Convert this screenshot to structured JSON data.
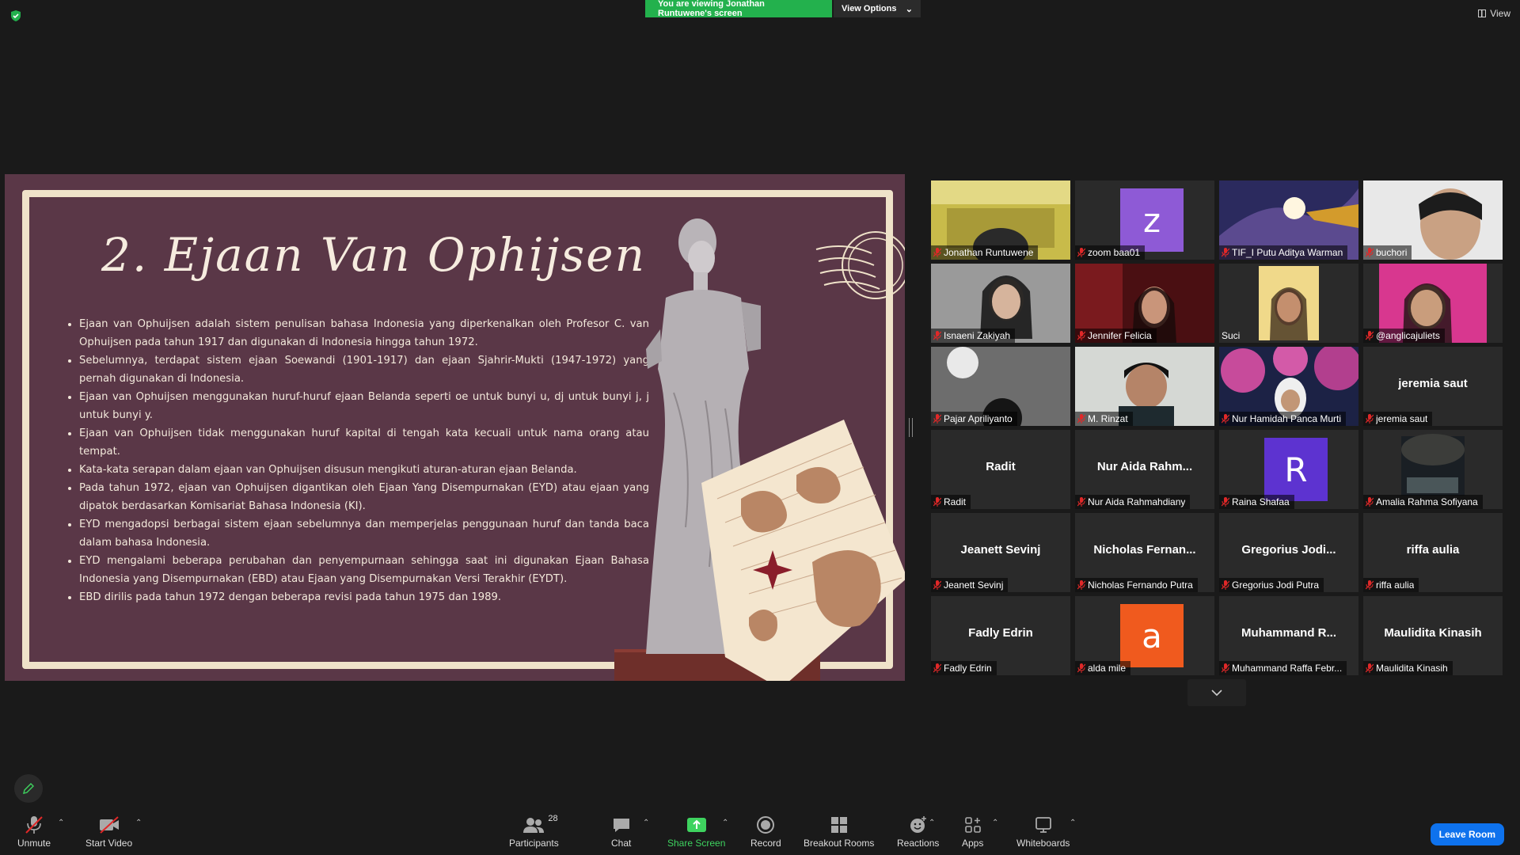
{
  "banner": {
    "viewing_text": "You are viewing Jonathan Runtuwene's screen",
    "view_options_label": "View Options"
  },
  "top_right": {
    "view_label": "View"
  },
  "slide": {
    "title": "2. Ejaan Van Ophijsen",
    "bullets": [
      "Ejaan van Ophuijsen adalah sistem penulisan bahasa Indonesia yang diperkenalkan oleh Profesor C. van Ophuijsen pada tahun 1917 dan digunakan di Indonesia hingga tahun 1972.",
      "Sebelumnya, terdapat sistem ejaan Soewandi (1901-1917) dan ejaan Sjahrir-Mukti (1947-1972) yang pernah digunakan di Indonesia.",
      "Ejaan van Ophuijsen menggunakan huruf-huruf ejaan Belanda seperti oe untuk bunyi u, dj untuk bunyi j, j untuk bunyi y.",
      "Ejaan van Ophuijsen tidak menggunakan huruf kapital di tengah kata kecuali untuk nama orang atau tempat.",
      "Kata-kata serapan dalam ejaan van Ophuijsen disusun mengikuti aturan-aturan ejaan Belanda.",
      "Pada tahun 1972, ejaan van Ophuijsen digantikan oleh Ejaan Yang Disempurnakan (EYD) atau ejaan yang dipatok berdasarkan Komisariat Bahasa Indonesia (KI).",
      "EYD mengadopsi berbagai sistem ejaan sebelumnya dan memperjelas penggunaan huruf dan tanda baca dalam bahasa Indonesia.",
      "EYD mengalami beberapa perubahan dan penyempurnaan sehingga saat ini digunakan Ejaan Bahasa Indonesia yang Disempurnakan (EBD) atau Ejaan yang Disempurnakan Versi Terakhir (EYDT).",
      "EBD dirilis pada tahun 1972 dengan beberapa revisi pada tahun 1975 dan 1989."
    ]
  },
  "participants": [
    {
      "name": "Jonathan Runtuwene",
      "type": "video",
      "scene": "yellow-room"
    },
    {
      "name": "zoom baa01",
      "type": "avatar",
      "letter": "z",
      "color": "#8e5ad6"
    },
    {
      "name": "TIF_I Putu Aditya Warman",
      "type": "video",
      "scene": "galaxy"
    },
    {
      "name": "buchori",
      "type": "video",
      "scene": "face-light"
    },
    {
      "name": "Isnaeni Zakiyah",
      "type": "video",
      "scene": "gray"
    },
    {
      "name": "Jennifer Felicia",
      "type": "video",
      "scene": "red"
    },
    {
      "name": "Suci",
      "type": "video",
      "scene": "yellow-face",
      "active": true
    },
    {
      "name": "@anglicajuliets",
      "type": "video",
      "scene": "pink"
    },
    {
      "name": "Pajar Apriliyanto",
      "type": "video",
      "scene": "dark-gray"
    },
    {
      "name": "M. Rinzat",
      "type": "video",
      "scene": "light-face"
    },
    {
      "name": "Nur Hamidah Panca Murti",
      "type": "video",
      "scene": "blossom"
    },
    {
      "name": "jeremia saut",
      "type": "name",
      "display": "jeremia saut"
    },
    {
      "name": "Radit",
      "type": "name",
      "display": "Radit"
    },
    {
      "name": "Nur Aida Rahmahdiany",
      "type": "name",
      "display": "Nur Aida Rahm..."
    },
    {
      "name": "Raina Shafaa",
      "type": "avatar",
      "letter": "R",
      "color": "#5d33d0"
    },
    {
      "name": "Amalia Rahma Sofiyana",
      "type": "video",
      "scene": "night"
    },
    {
      "name": "Jeanett Sevinj",
      "type": "name",
      "display": "Jeanett Sevinj"
    },
    {
      "name": "Nicholas Fernando Putra",
      "type": "name",
      "display": "Nicholas Fernan..."
    },
    {
      "name": "Gregorius Jodi Putra",
      "type": "name",
      "display": "Gregorius Jodi..."
    },
    {
      "name": "riffa aulia",
      "type": "name",
      "display": "riffa aulia"
    },
    {
      "name": "Fadly Edrin",
      "type": "name",
      "display": "Fadly Edrin"
    },
    {
      "name": "alda mile",
      "type": "avatar",
      "letter": "a",
      "color": "#f05a1e"
    },
    {
      "name": "Muhammand Raffa Febr...",
      "type": "name",
      "display": "Muhammand R..."
    },
    {
      "name": "Maulidita Kinasih",
      "type": "name",
      "display": "Maulidita Kinasih"
    }
  ],
  "toolbar": {
    "unmute_label": "Unmute",
    "start_video_label": "Start Video",
    "participants_label": "Participants",
    "participants_count": "28",
    "chat_label": "Chat",
    "share_screen_label": "Share Screen",
    "record_label": "Record",
    "breakout_label": "Breakout Rooms",
    "reactions_label": "Reactions",
    "apps_label": "Apps",
    "whiteboards_label": "Whiteboards",
    "leave_label": "Leave Room"
  },
  "colors": {
    "share_green": "#3ed35f",
    "leave_blue": "#0e72ed",
    "banner_green": "#23b14d",
    "active_speaker": "#e6e22b",
    "slide_bg": "#5a3747"
  }
}
